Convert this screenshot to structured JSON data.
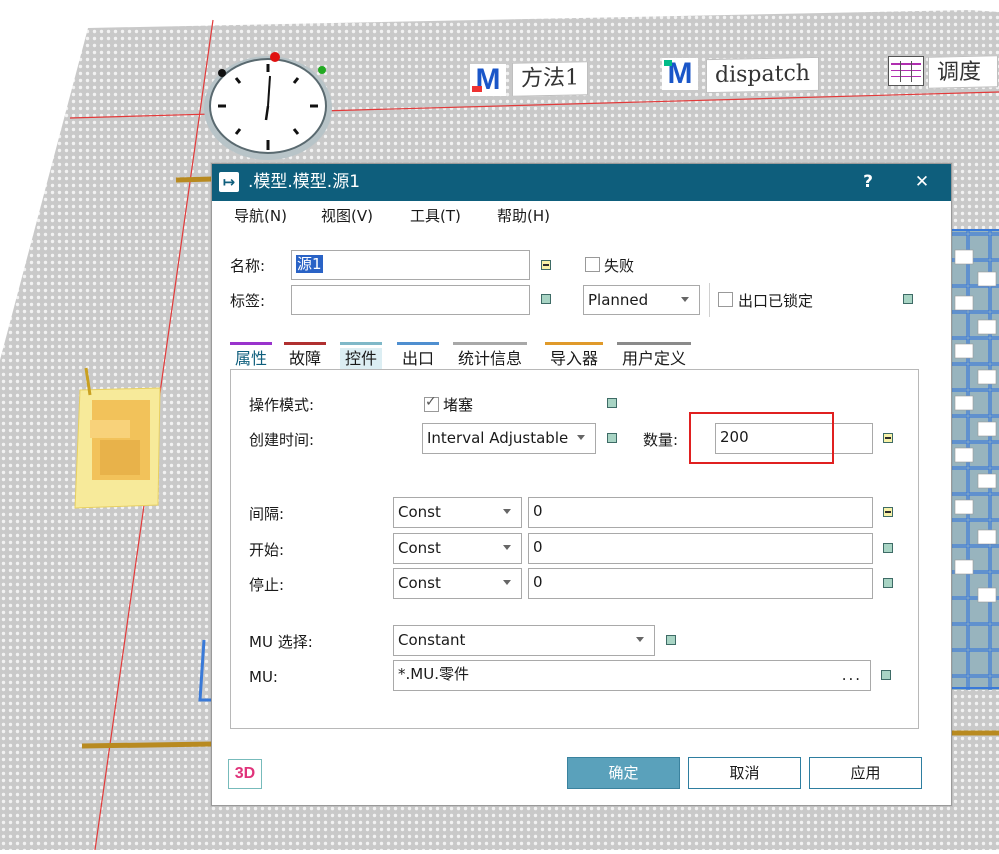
{
  "scene": {
    "method_label": "方法1",
    "dispatch_label": "dispatch",
    "schedule_label": "调度"
  },
  "dialog": {
    "title": ".模型.模型.源1",
    "help_button": "?",
    "close_button": "✕",
    "menu": [
      "导航(N)",
      "视图(V)",
      "工具(T)",
      "帮助(H)"
    ],
    "name_label": "名称:",
    "name_value": "源1",
    "tag_label": "标签:",
    "tag_value": "",
    "failed_label": "失败",
    "failed_checked": false,
    "state_value": "Planned",
    "exit_locked_label": "出口已锁定",
    "exit_locked_checked": false,
    "tabs": [
      {
        "label": "属性",
        "color": "#9933cc",
        "active": true
      },
      {
        "label": "故障",
        "color": "#b03030",
        "active": false
      },
      {
        "label": "控件",
        "color": "#7fb8c8",
        "active": false
      },
      {
        "label": "出口",
        "color": "#4f8fd0",
        "active": false
      },
      {
        "label": "统计信息",
        "color": "#a8a8a8",
        "active": false
      },
      {
        "label": "导入器",
        "color": "#e09a2a",
        "active": false
      },
      {
        "label": "用户定义",
        "color": "#8a8a8a",
        "active": false
      }
    ],
    "operating_mode_label": "操作模式:",
    "blocking_label": "堵塞",
    "blocking_checked": true,
    "creation_time_label": "创建时间:",
    "creation_time_value": "Interval Adjustable",
    "quantity_label": "数量:",
    "quantity_value": "200",
    "interval_label": "间隔:",
    "interval_dist": "Const",
    "interval_value": "0",
    "start_label": "开始:",
    "start_dist": "Const",
    "start_value": "0",
    "stop_label": "停止:",
    "stop_dist": "Const",
    "stop_value": "0",
    "mu_selection_label": "MU 选择:",
    "mu_selection_value": "Constant",
    "mu_label": "MU:",
    "mu_value": "*.MU.零件",
    "mu_browse": "...",
    "btn_3d": "3D",
    "ok_label": "确定",
    "cancel_label": "取消",
    "apply_label": "应用",
    "highlight_color": "#e02020",
    "title_bar_color": "#0e5e7c"
  }
}
